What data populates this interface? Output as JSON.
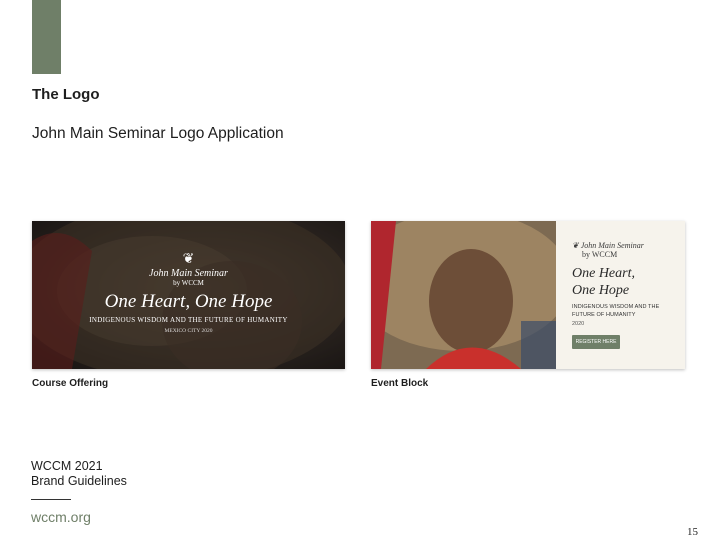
{
  "section": {
    "title": "The Logo",
    "subtitle": "John Main Seminar Logo Application"
  },
  "course_offering": {
    "caption": "Course Offering",
    "logo_line1": "John Main Seminar",
    "logo_line2": "by WCCM",
    "headline": "One Heart, One Hope",
    "tagline": "Indigenous Wisdom and the Future of Humanity",
    "location": "Mexico City 2020"
  },
  "event_block": {
    "caption": "Event Block",
    "logo_line1": "John Main Seminar",
    "logo_line2": "by WCCM",
    "headline_line1": "One Heart,",
    "headline_line2": "One Hope",
    "tagline": "Indigenous Wisdom and the Future of Humanity",
    "year": "2020",
    "button": "Register Here"
  },
  "footer": {
    "line1": "WCCM 2021",
    "line2": "Brand Guidelines",
    "url": "wccm.org",
    "page_number": "15"
  },
  "colors": {
    "accent": "#6f7f68"
  }
}
